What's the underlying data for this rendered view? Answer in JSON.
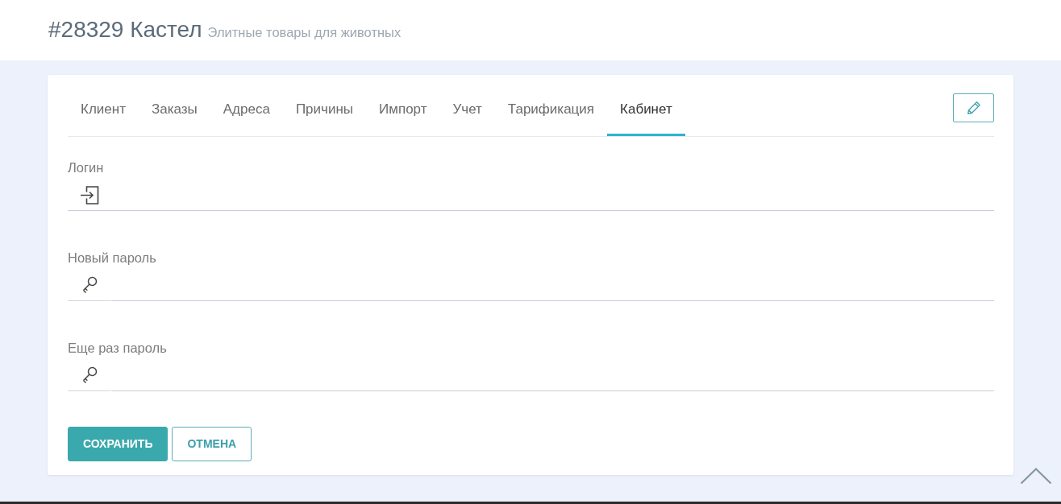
{
  "header": {
    "title": "#28329 Кастел",
    "subtitle": "Элитные товары для животных"
  },
  "tabs": [
    {
      "label": "Клиент",
      "selected": false
    },
    {
      "label": "Заказы",
      "selected": false
    },
    {
      "label": "Адреса",
      "selected": false
    },
    {
      "label": "Причины",
      "selected": false
    },
    {
      "label": "Импорт",
      "selected": false
    },
    {
      "label": "Учет",
      "selected": false
    },
    {
      "label": "Тарификация",
      "selected": false
    },
    {
      "label": "Кабинет",
      "selected": true
    }
  ],
  "fields": [
    {
      "label": "Логин",
      "kind": "login"
    },
    {
      "label": "Новый пароль",
      "kind": "password"
    },
    {
      "label": "Еще раз пароль",
      "kind": "password"
    }
  ],
  "buttons": [
    {
      "label": "СОХРАНИТЬ",
      "kind": "primary"
    },
    {
      "label": "ОТМЕНА",
      "kind": "secondary"
    }
  ]
}
